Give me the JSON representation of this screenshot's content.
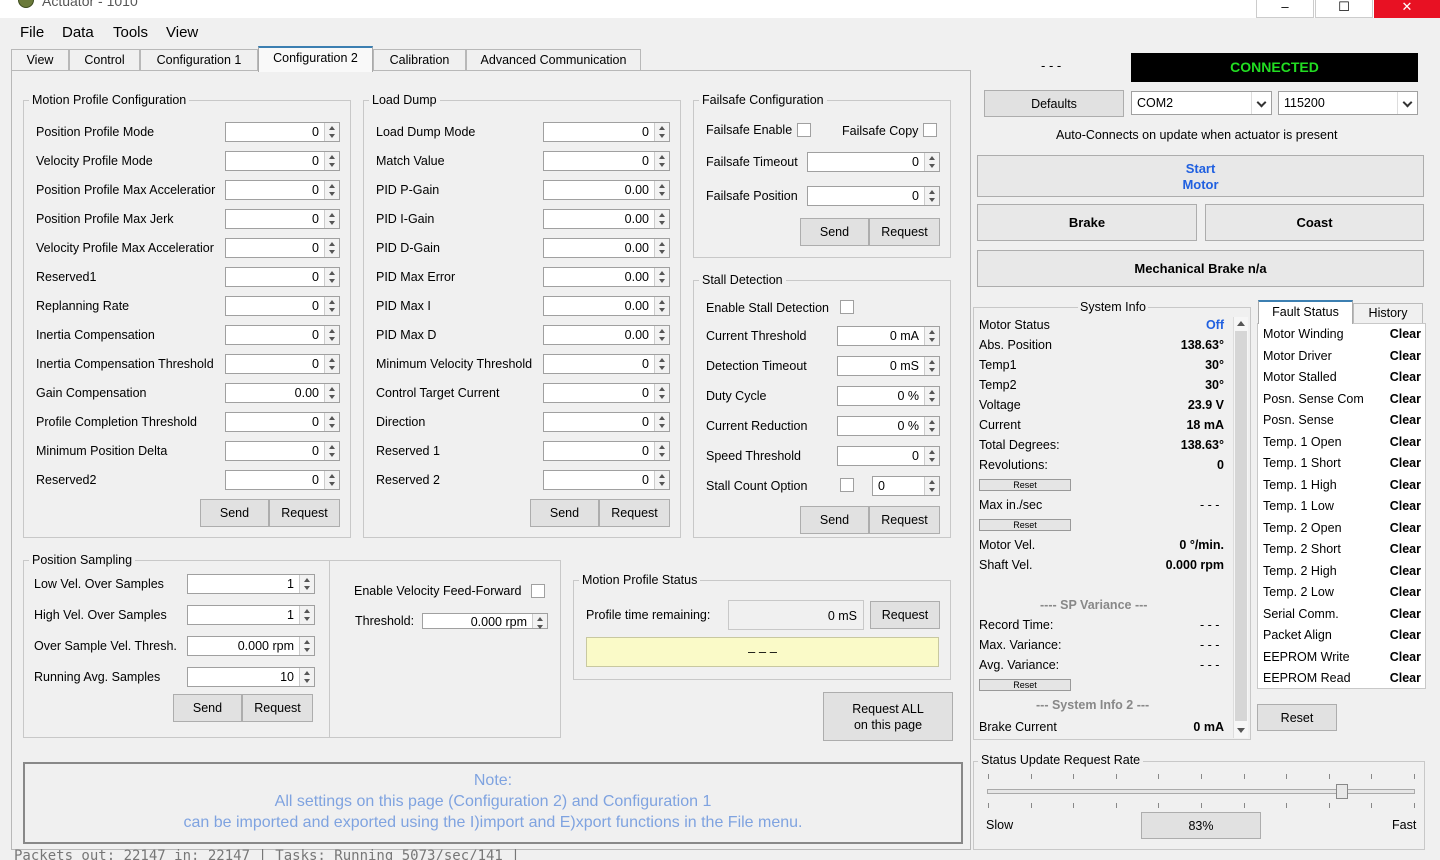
{
  "window": {
    "title": "Actuator - 1010",
    "minimize": "–",
    "maximize": "☐",
    "close": "✕"
  },
  "menu": [
    "File",
    "Data",
    "Tools",
    "View"
  ],
  "tabs": [
    "View",
    "Control",
    "Configuration 1",
    "Configuration 2",
    "Calibration",
    "Advanced Communication"
  ],
  "motion_profile": {
    "title": "Motion Profile Configuration",
    "rows": [
      {
        "label": "Position Profile Mode",
        "value": "0"
      },
      {
        "label": "Velocity Profile Mode",
        "value": "0"
      },
      {
        "label": "Position Profile Max Acceleratior",
        "value": "0"
      },
      {
        "label": "Position Profile Max Jerk",
        "value": "0"
      },
      {
        "label": "Velocity Profile Max Acceleratior",
        "value": "0"
      },
      {
        "label": "Reserved1",
        "value": "0"
      },
      {
        "label": "Replanning Rate",
        "value": "0"
      },
      {
        "label": "Inertia Compensation",
        "value": "0"
      },
      {
        "label": "Inertia Compensation Threshold",
        "value": "0"
      },
      {
        "label": "Gain Compensation",
        "value": "0.00"
      },
      {
        "label": "Profile Completion Threshold",
        "value": "0"
      },
      {
        "label": "Minimum Position Delta",
        "value": "0"
      },
      {
        "label": "Reserved2",
        "value": "0"
      }
    ],
    "send": "Send",
    "request": "Request"
  },
  "load_dump": {
    "title": "Load Dump",
    "rows": [
      {
        "label": "Load Dump Mode",
        "value": "0"
      },
      {
        "label": "Match Value",
        "value": "0"
      },
      {
        "label": "PID  P-Gain",
        "value": "0.00"
      },
      {
        "label": "PID  I-Gain",
        "value": "0.00"
      },
      {
        "label": "PID  D-Gain",
        "value": "0.00"
      },
      {
        "label": "PID Max Error",
        "value": "0.00"
      },
      {
        "label": "PID Max I",
        "value": "0.00"
      },
      {
        "label": "PID Max D",
        "value": "0.00"
      },
      {
        "label": "Minimum Velocity Threshold",
        "value": "0"
      },
      {
        "label": "Control Target Current",
        "value": "0"
      },
      {
        "label": "Direction",
        "value": "0"
      },
      {
        "label": "Reserved 1",
        "value": "0"
      },
      {
        "label": "Reserved 2",
        "value": "0"
      }
    ],
    "send": "Send",
    "request": "Request"
  },
  "failsafe": {
    "title": "Failsafe Configuration",
    "enable_label": "Failsafe Enable",
    "copy_label": "Failsafe Copy",
    "timeout_label": "Failsafe Timeout",
    "timeout_value": "0",
    "position_label": "Failsafe Position",
    "position_value": "0",
    "send": "Send",
    "request": "Request"
  },
  "stall": {
    "title": "Stall Detection",
    "enable_label": "Enable Stall Detection",
    "rows": [
      {
        "label": "Current Threshold",
        "value": "0 mA"
      },
      {
        "label": "Detection Timeout",
        "value": "0 mS"
      },
      {
        "label": "Duty Cycle",
        "value": "0 %"
      },
      {
        "label": "Current Reduction",
        "value": "0 %"
      },
      {
        "label": "Speed Threshold",
        "value": "0"
      }
    ],
    "count_label": "Stall Count Option",
    "count_value": "0",
    "send": "Send",
    "request": "Request"
  },
  "position_sampling": {
    "title": "Position Sampling",
    "rows": [
      {
        "label": "Low Vel. Over Samples",
        "value": "1"
      },
      {
        "label": "High Vel. Over Samples",
        "value": "1"
      },
      {
        "label": "Over Sample Vel. Thresh.",
        "value": "0.000 rpm"
      },
      {
        "label": "Running Avg. Samples",
        "value": "10"
      }
    ],
    "send": "Send",
    "request": "Request"
  },
  "velocity_ff": {
    "enable_label": "Enable Velocity Feed-Forward",
    "threshold_label": "Threshold:",
    "threshold_value": "0.000 rpm"
  },
  "motion_status": {
    "title": "Motion Profile Status",
    "time_label": "Profile time remaining:",
    "time_value": "0 mS",
    "request": "Request",
    "display": "–  –  –"
  },
  "request_all": {
    "line1": "Request ALL",
    "line2": "on this page"
  },
  "note": {
    "line0": "Note:",
    "line1": "All settings on this page (Configuration 2) and Configuration 1",
    "line2": "can be imported and exported using the I)import and E)xport functions in the File menu."
  },
  "status_line": "Packets out: 22147  in: 22147   |   Tasks: Running 5073/sec/141   |",
  "right": {
    "dashes": "- - -",
    "connection": "CONNECTED",
    "defaults": "Defaults",
    "port": "COM2",
    "baud": "115200",
    "auto_text": "Auto-Connects on update when actuator is present",
    "start_motor_1": "Start",
    "start_motor_2": "Motor",
    "brake": "Brake",
    "coast": "Coast",
    "mech_brake": "Mechanical Brake n/a",
    "sysinfo_title": "System Info",
    "rows": [
      {
        "label": "Motor Status",
        "value": "Off"
      },
      {
        "label": "Abs. Position",
        "value": "138.63°"
      },
      {
        "label": "Temp1",
        "value": "30°"
      },
      {
        "label": "Temp2",
        "value": "30°"
      },
      {
        "label": "Voltage",
        "value": "23.9 V"
      },
      {
        "label": "Current",
        "value": "18 mA"
      },
      {
        "label": "Total Degrees:",
        "value": "138.63°"
      },
      {
        "label": "Revolutions:",
        "value": "0"
      }
    ],
    "reset": "Reset",
    "max_in_sec": "Max in./sec",
    "max_in_sec_value": "- - -",
    "motor_vel": "Motor Vel.",
    "motor_vel_value": "0 °/min.",
    "shaft_vel": "Shaft Vel.",
    "shaft_vel_value": "0.000 rpm",
    "sp_variance": "---- SP Variance ---",
    "record_time": "Record Time:",
    "max_variance": "Max. Variance:",
    "avg_variance": "Avg. Variance:",
    "variance_value": "- - -",
    "sysinfo2": "--- System Info 2 ---",
    "brake_current": "Brake Current",
    "brake_current_value": "0 mA",
    "fault_tab": "Fault Status",
    "history_tab": "History",
    "faults": [
      {
        "label": "Motor Winding",
        "value": "Clear"
      },
      {
        "label": "Motor Driver",
        "value": "Clear"
      },
      {
        "label": "Motor Stalled",
        "value": "Clear"
      },
      {
        "label": "Posn. Sense Com",
        "value": "Clear"
      },
      {
        "label": "Posn. Sense",
        "value": "Clear"
      },
      {
        "label": "Temp. 1 Open",
        "value": "Clear"
      },
      {
        "label": "Temp. 1 Short",
        "value": "Clear"
      },
      {
        "label": "Temp. 1 High",
        "value": "Clear"
      },
      {
        "label": "Temp. 1 Low",
        "value": "Clear"
      },
      {
        "label": "Temp. 2 Open",
        "value": "Clear"
      },
      {
        "label": "Temp. 2 Short",
        "value": "Clear"
      },
      {
        "label": "Temp. 2 High",
        "value": "Clear"
      },
      {
        "label": "Temp. 2 Low",
        "value": "Clear"
      },
      {
        "label": "Serial Comm.",
        "value": "Clear"
      },
      {
        "label": "Packet Align",
        "value": "Clear"
      },
      {
        "label": "EEPROM Write",
        "value": "Clear"
      },
      {
        "label": "EEPROM Read",
        "value": "Clear"
      }
    ],
    "fault_reset": "Reset",
    "rate_title": "Status Update Request Rate",
    "slow": "Slow",
    "fast": "Fast",
    "rate_value": "83%",
    "rate_level": 0.83
  },
  "colors": {
    "connected_bg": "#000000",
    "connected_fg": "#22dd22",
    "note_text": "#7fa3e0",
    "motor_off": "#2060e0",
    "status_display": "#fafac8"
  }
}
